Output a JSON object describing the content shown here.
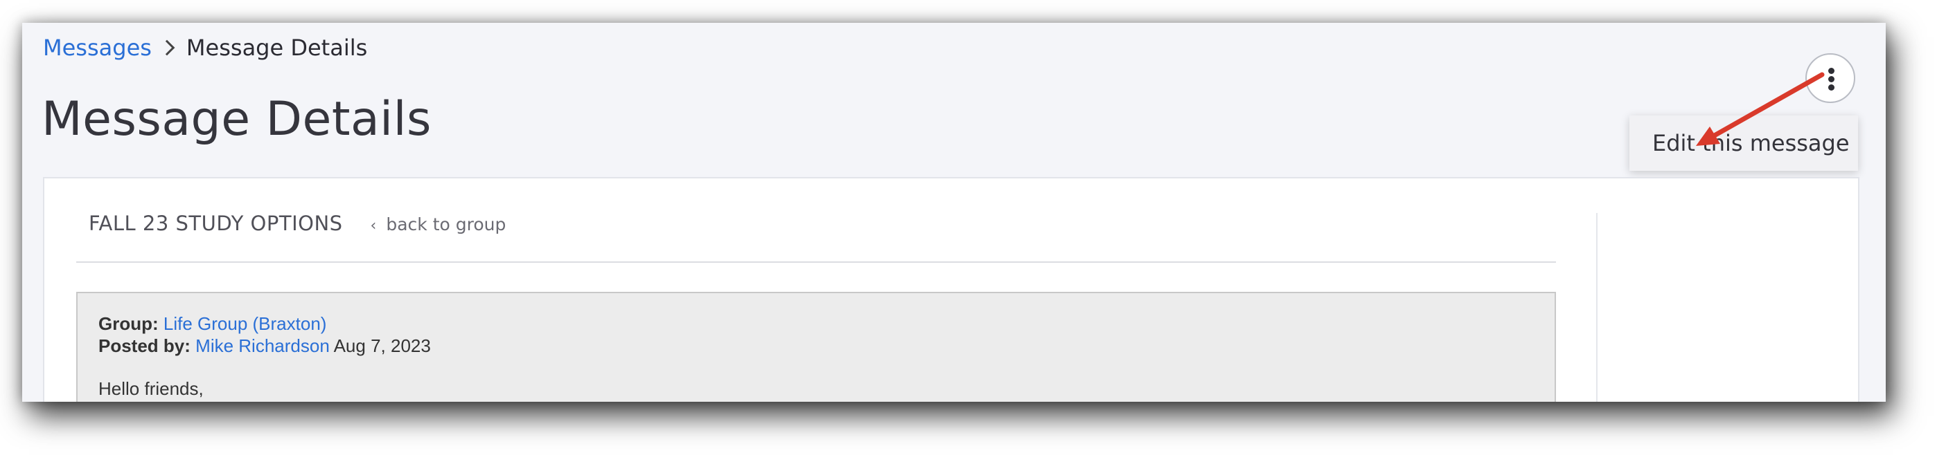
{
  "breadcrumb": {
    "parent": "Messages",
    "current": "Message Details"
  },
  "page": {
    "title": "Message Details"
  },
  "menu": {
    "edit_label": "Edit this message"
  },
  "card": {
    "group_name": "FALL 23 STUDY OPTIONS",
    "back_label": "back to group"
  },
  "message": {
    "group_label": "Group:",
    "group_value": "Life Group (Braxton)",
    "posted_label": "Posted by:",
    "author": "Mike Richardson",
    "date": "Aug 7, 2023",
    "greeting": "Hello friends,"
  },
  "colors": {
    "link": "#2a6fd6",
    "annotation_arrow": "#d93a2b"
  },
  "icons": {
    "kebab": "kebab-menu-icon",
    "breadcrumb_separator": "chevron-right-icon",
    "back": "chevron-left-icon"
  }
}
